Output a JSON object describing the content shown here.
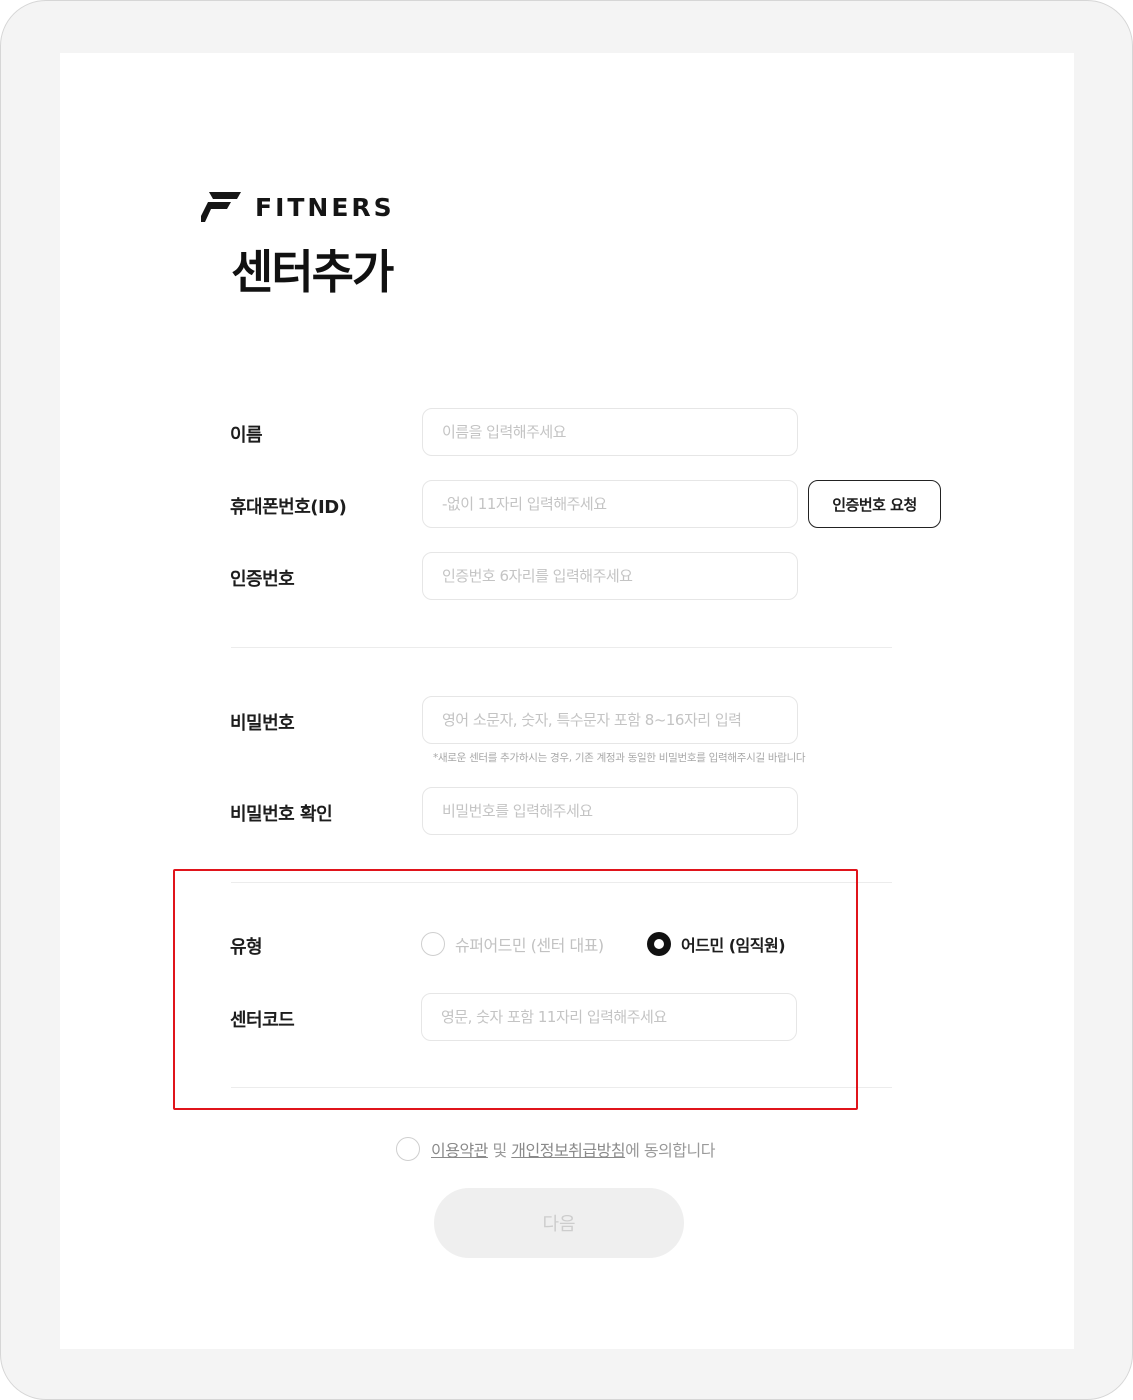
{
  "brand": {
    "name": "FITNERS",
    "icon": "fitners-logo-icon"
  },
  "page": {
    "title": "센터추가"
  },
  "form": {
    "name": {
      "label": "이름",
      "placeholder": "이름을 입력해주세요",
      "value": ""
    },
    "phone": {
      "label": "휴대폰번호(ID)",
      "placeholder": "-없이 11자리 입력해주세요",
      "value": "",
      "request_button": "인증번호 요청"
    },
    "auth_code": {
      "label": "인증번호",
      "placeholder": "인증번호 6자리를 입력해주세요",
      "value": ""
    },
    "password": {
      "label": "비밀번호",
      "placeholder": "영어 소문자, 숫자, 특수문자 포함 8~16자리 입력",
      "value": "",
      "hint": "*새로운 센터를 추가하시는 경우, 기존 계정과 동일한 비밀번호를 입력해주시길 바랍니다"
    },
    "password_confirm": {
      "label": "비밀번호 확인",
      "placeholder": "비밀번호를 입력해주세요",
      "value": ""
    },
    "type": {
      "label": "유형",
      "options": [
        {
          "label": "슈퍼어드민 (센터 대표)",
          "selected": false
        },
        {
          "label": "어드민 (임직원)",
          "selected": true
        }
      ]
    },
    "center_code": {
      "label": "센터코드",
      "placeholder": "영문, 숫자 포함 11자리 입력해주세요",
      "value": ""
    }
  },
  "agreement": {
    "checked": false,
    "terms_link": "이용약관",
    "and_text": " 및 ",
    "privacy_link": "개인정보취급방침",
    "suffix": "에 동의합니다"
  },
  "next_button": "다음",
  "colors": {
    "highlight": "#e0141b",
    "frame": "#f4f4f4",
    "disabled_button": "#efefef"
  }
}
